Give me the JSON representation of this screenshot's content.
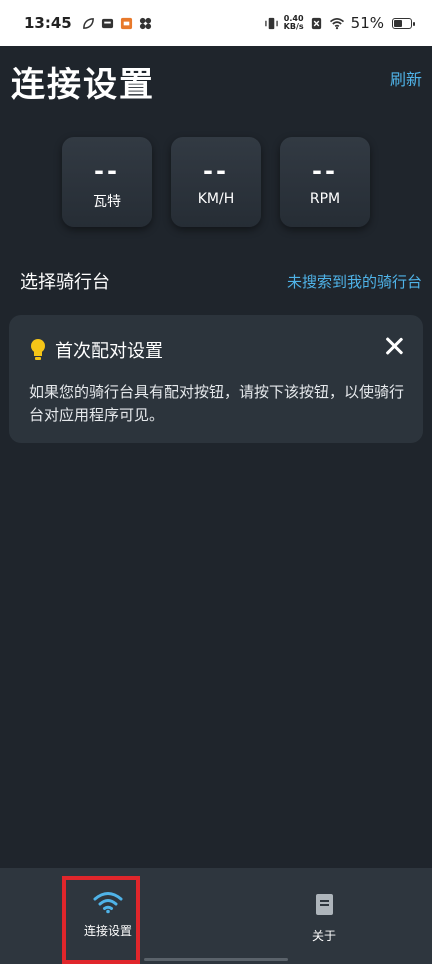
{
  "status_bar": {
    "time": "13:45",
    "net_speed_value": "0.40",
    "net_speed_unit": "KB/s",
    "battery": "51%",
    "battery_level": 0.51
  },
  "header": {
    "title": "连接设置",
    "refresh_label": "刷新"
  },
  "metrics": [
    {
      "value": "--",
      "unit": "瓦特"
    },
    {
      "value": "--",
      "unit": "KM/H"
    },
    {
      "value": "--",
      "unit": "RPM"
    }
  ],
  "trainer": {
    "label": "选择骑行台",
    "not_found_link": "未搜索到我的骑行台"
  },
  "pairing_card": {
    "title": "首次配对设置",
    "body": "如果您的骑行台具有配对按钮，请按下该按钮，以使骑行台对应用程序可见。"
  },
  "bottom_nav": {
    "items": [
      {
        "label": "连接设置",
        "icon": "wifi-icon",
        "active": true
      },
      {
        "label": "关于",
        "icon": "document-icon",
        "active": false
      }
    ]
  },
  "colors": {
    "background": "#1f252c",
    "accent": "#4fb3e8",
    "highlight": "#e0262b",
    "bulb": "#f5c518"
  }
}
